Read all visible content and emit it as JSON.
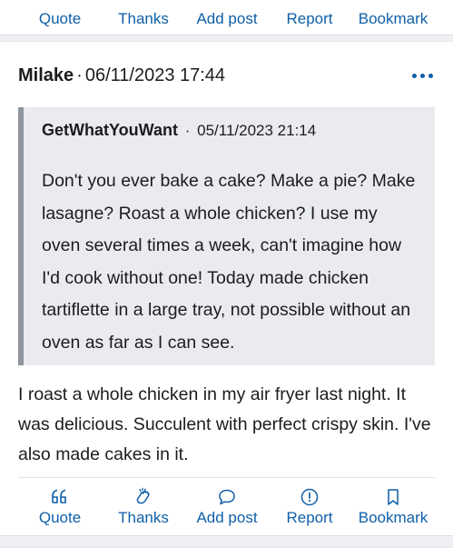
{
  "actions": {
    "quote": "Quote",
    "thanks": "Thanks",
    "add_post": "Add post",
    "report": "Report",
    "bookmark": "Bookmark"
  },
  "post": {
    "author": "Milake",
    "separator": "·",
    "date": "06/11/2023 17:44",
    "quote": {
      "author": "GetWhatYouWant",
      "separator": "·",
      "date": "05/11/2023 21:14",
      "text": "Don't you ever bake a cake? Make a pie? Make lasagne? Roast a whole chicken? I use my oven several times a week, can't imagine how I'd cook without one! Today made chicken tartiflette in a large tray, not possible without an oven as far as I can see."
    },
    "body": "I roast a whole chicken in my air fryer last night. It was delicious. Succulent with perfect crispy skin. I've also made cakes in it."
  },
  "colors": {
    "accent": "#0f5fa8",
    "quote_background": "#e9ebef",
    "quote_border": "#8f959d"
  },
  "icons": {
    "quote": "quote-icon",
    "thanks": "clapping-hands-icon",
    "add_post": "speech-bubble-icon",
    "report": "exclamation-circle-icon",
    "bookmark": "bookmark-icon",
    "more": "more-dots-icon"
  }
}
